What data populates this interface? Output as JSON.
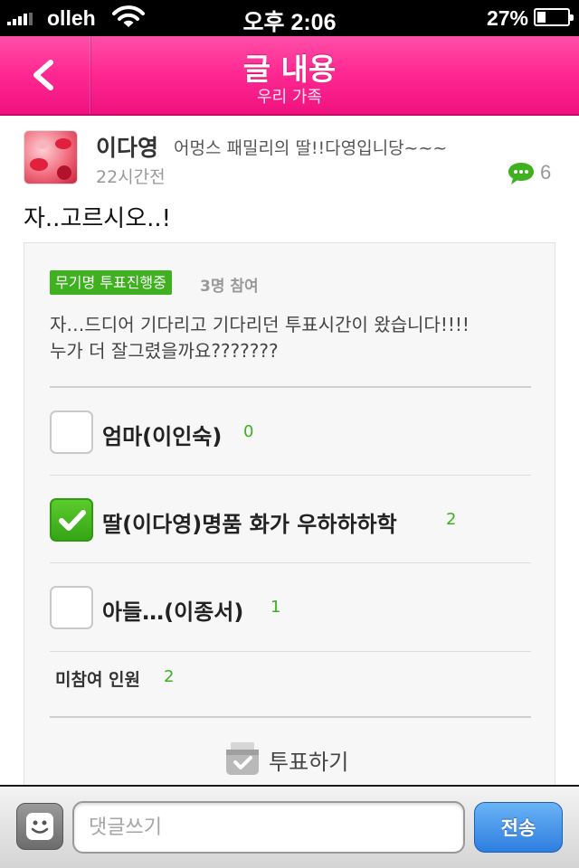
{
  "status_bar": {
    "carrier": "olleh",
    "time": "오후 2:06",
    "battery_percent": "27%",
    "battery_level": 0.27,
    "icons": [
      "signal-icon",
      "wifi-icon",
      "battery-icon"
    ]
  },
  "nav": {
    "title": "글 내용",
    "subtitle": "우리 가족",
    "back_icon": "chevron-left-icon",
    "color": "#ff2a92"
  },
  "post": {
    "author": "이다영",
    "author_intro": "어멍스 패밀리의 딸!!다영입니당~~~",
    "time_ago": "22시간전",
    "comment_count": "6",
    "body": "자..고르시오..!"
  },
  "vote": {
    "badge": "무기명 투표진행중",
    "participants": "3명 참여",
    "question_line1": "자…드디어 기다리고 기다리던 투표시간이 왔습니다!!!!",
    "question_line2": "누가 더 잘그렸을까요???????",
    "options": [
      {
        "label": "엄마(이인숙)",
        "count": "0",
        "checked": false
      },
      {
        "label": "딸(이다영)명품 화가 우하하하학",
        "count": "2",
        "checked": true
      },
      {
        "label": "아들…(이종서)",
        "count": "1",
        "checked": false
      }
    ],
    "non_participants_label": "미참여 인원",
    "non_participants_count": "2",
    "vote_button": "투표하기",
    "accent_color": "#3fb020"
  },
  "comment_bar": {
    "placeholder": "댓글쓰기",
    "send_label": "전송"
  }
}
